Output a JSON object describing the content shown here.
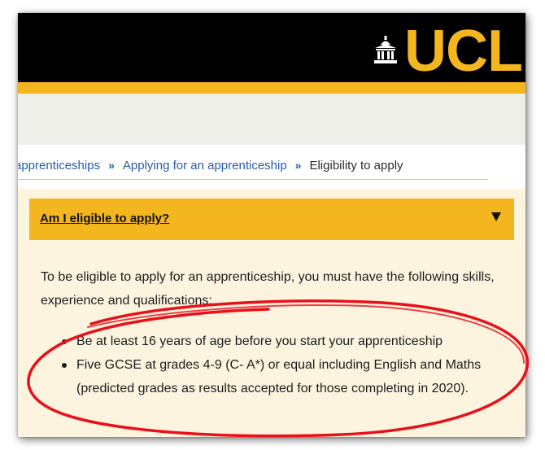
{
  "header": {
    "logo_text": "UCL",
    "logo_icon": "portico-building-icon",
    "brand_color": "#f3b61f"
  },
  "breadcrumb": {
    "items": [
      "apprenticeships",
      "Applying for an apprenticeship",
      "Eligibility to apply"
    ],
    "separator": "»"
  },
  "accordion": {
    "title": "Am I eligible to apply?",
    "toggle_icon": "caret-down-icon",
    "intro": "To be eligible to apply for an apprenticeship, you must have the following skills, experience and qualifications:",
    "bullets": [
      "Be at least 16 years of age before you start your apprenticeship",
      "Five GCSE at grades 4-9 (C- A*) or equal including English and Maths (predicted grades as results accepted for those completing in 2020)."
    ]
  },
  "annotation": {
    "shape": "hand-drawn-ellipse",
    "color": "#e8101a"
  }
}
